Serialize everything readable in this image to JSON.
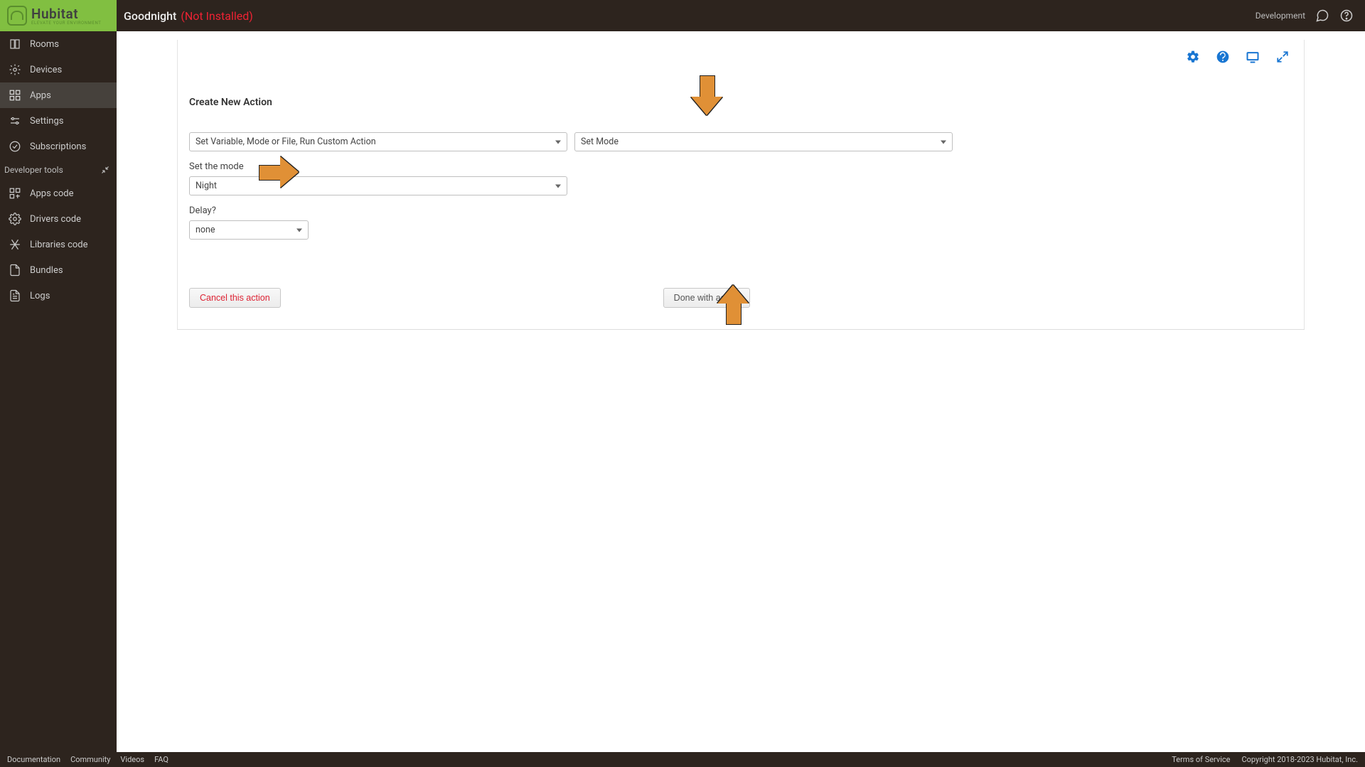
{
  "header": {
    "logoName": "Hubitat",
    "logoSub": "ELEVATE YOUR ENVIRONMENT",
    "pageTitle": "Goodnight",
    "pageStatus": "(Not Installed)",
    "devLabel": "Development"
  },
  "sidebar": {
    "items": [
      {
        "label": "Rooms"
      },
      {
        "label": "Devices"
      },
      {
        "label": "Apps"
      },
      {
        "label": "Settings"
      },
      {
        "label": "Subscriptions"
      }
    ],
    "devHeader": "Developer tools",
    "devItems": [
      {
        "label": "Apps code"
      },
      {
        "label": "Drivers code"
      },
      {
        "label": "Libraries code"
      },
      {
        "label": "Bundles"
      },
      {
        "label": "Logs"
      }
    ]
  },
  "panel": {
    "heading": "Create New Action",
    "actionTypeSelect": "Set Variable, Mode or File, Run Custom Action",
    "subActionSelect": "Set Mode",
    "modeLabel": "Set the mode",
    "modeValue": "Night",
    "delayLabel": "Delay?",
    "delayValue": "none",
    "cancelBtn": "Cancel this action",
    "doneBtn": "Done with action"
  },
  "footer": {
    "links": [
      "Documentation",
      "Community",
      "Videos",
      "FAQ"
    ],
    "tos": "Terms of Service",
    "copyright": "Copyright 2018-2023 Hubitat, Inc."
  }
}
